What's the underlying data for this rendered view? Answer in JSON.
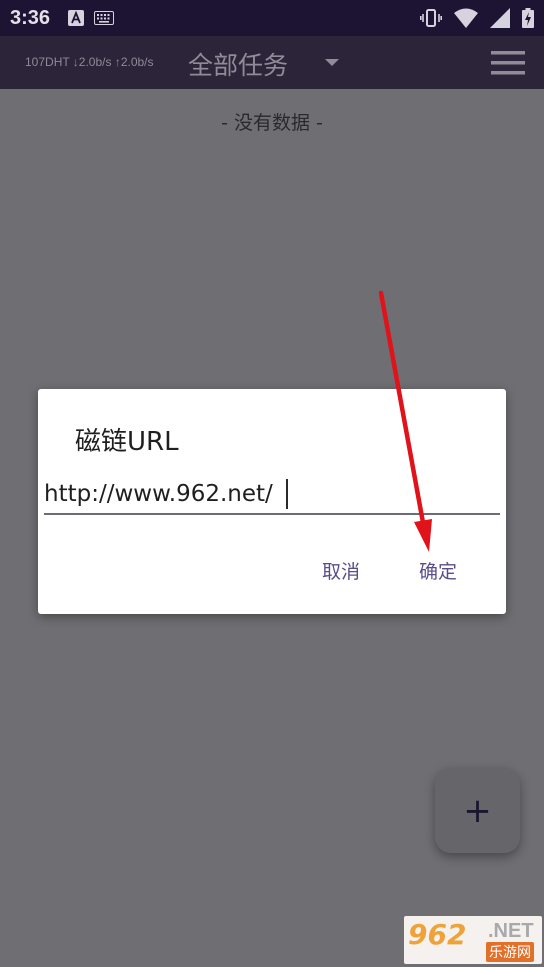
{
  "status_bar": {
    "time": "3:36"
  },
  "app_bar": {
    "speed_info": "107DHT ↓2.0b/s ↑2.0b/s",
    "title": "全部任务"
  },
  "empty_text": "- 没有数据 -",
  "dialog": {
    "title": "磁链URL",
    "url_value": "http://www.962.net/",
    "cancel_label": "取消",
    "ok_label": "确定"
  },
  "fab": {
    "label": "+"
  },
  "watermark": {
    "number": "962",
    "net": ".NET",
    "sub": "乐游网"
  },
  "colors": {
    "status_bar_bg": "#1d1433",
    "app_bar_bg": "#2c2438",
    "scrim": "#6f6e72",
    "dialog_button": "#5b4d8a",
    "arrow": "#e0121a"
  }
}
